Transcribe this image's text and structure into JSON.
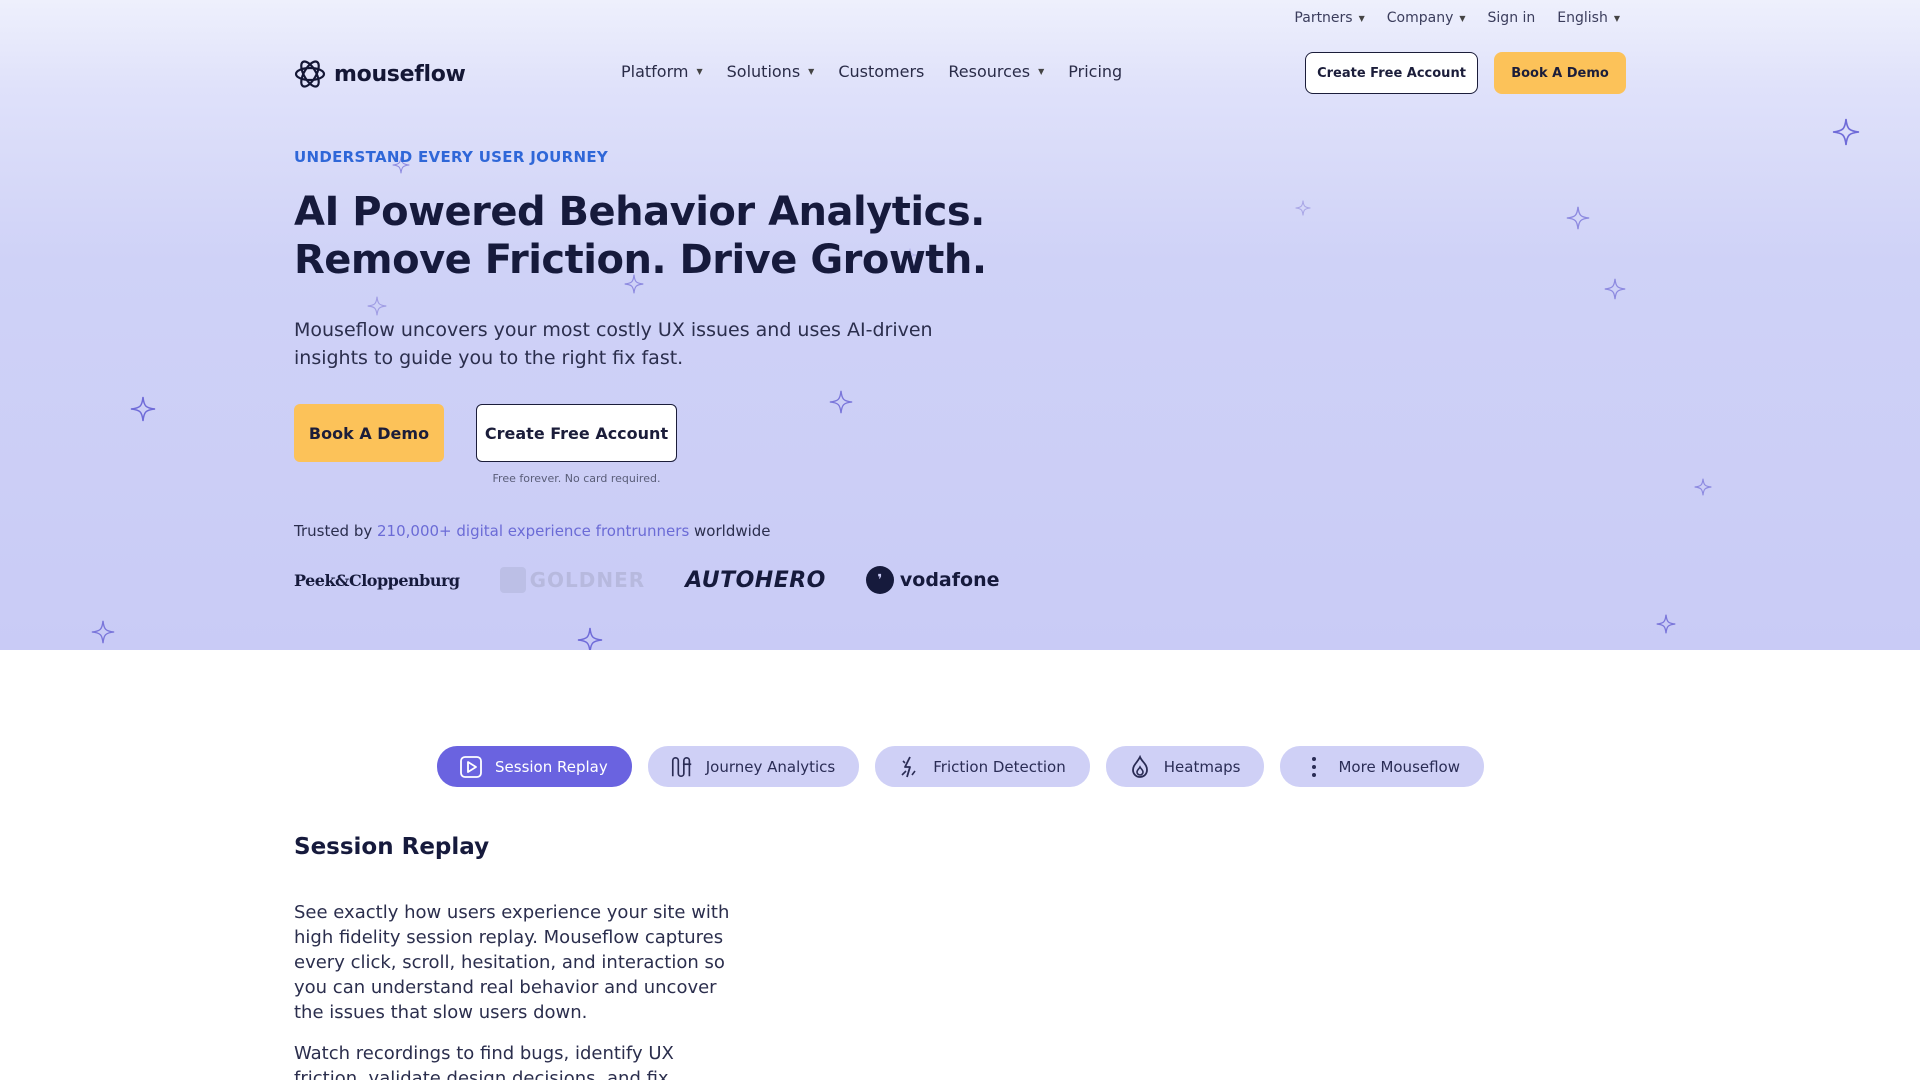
{
  "utility_nav": {
    "partners": "Partners",
    "company": "Company",
    "sign_in": "Sign in",
    "language": "English"
  },
  "brand": {
    "name": "mouseflow"
  },
  "main_nav": {
    "platform": "Platform",
    "solutions": "Solutions",
    "customers": "Customers",
    "resources": "Resources",
    "pricing": "Pricing"
  },
  "header_buttons": {
    "create": "Create Free Account",
    "demo": "Book A Demo"
  },
  "hero": {
    "eyebrow": "UNDERSTAND EVERY USER JOURNEY",
    "headline_line1": "AI Powered Behavior Analytics.",
    "headline_line2": "Remove Friction. Drive Growth.",
    "subtitle": "Mouseflow uncovers your most costly UX issues and uses AI-driven insights to guide you to the right fix fast.",
    "cta_demo": "Book A Demo",
    "cta_create": "Create Free Account",
    "fineprint": "Free forever. No card required.",
    "trusted_prefix": "Trusted by ",
    "trusted_highlight": "210,000+ digital experience frontrunners",
    "trusted_suffix": " worldwide"
  },
  "customer_logos": {
    "peek": "Peek&Cloppenburg",
    "goldner": "GOLDNER",
    "autohero": "AUTOHERO",
    "vodafone": "vodafone"
  },
  "feature_tabs": [
    {
      "label": "Session Replay",
      "icon": "play-icon",
      "active": true
    },
    {
      "label": "Journey Analytics",
      "icon": "journey-icon",
      "active": false
    },
    {
      "label": "Friction Detection",
      "icon": "friction-icon",
      "active": false
    },
    {
      "label": "Heatmaps",
      "icon": "flame-icon",
      "active": false
    },
    {
      "label": "More Mouseflow",
      "icon": "more-dots-icon",
      "active": false
    }
  ],
  "section": {
    "title": "Session Replay",
    "paragraph1": "See exactly how users experience your site with high fidelity session replay. Mouseflow captures every click, scroll, hesitation, and interaction so you can understand real behavior and uncover the issues that slow users down.",
    "paragraph2": "Watch recordings to find bugs, identify UX friction, validate design decisions, and fix"
  },
  "colors": {
    "accent_yellow": "#fcc259",
    "accent_purple": "#6a63e0",
    "eyebrow_blue": "#2f67d8",
    "hero_bg": "#c9cbf6",
    "ink": "#161a3c"
  }
}
